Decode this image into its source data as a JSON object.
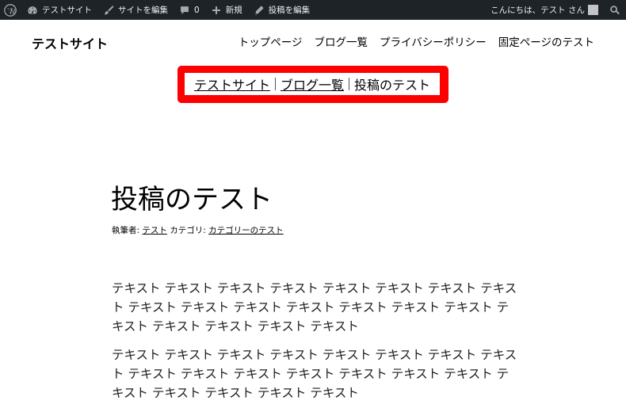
{
  "adminbar": {
    "site_name": "テストサイト",
    "edit_site": "サイトを編集",
    "comments_count": "0",
    "new": "新規",
    "edit_post": "投稿を編集",
    "greeting": "こんにちは、テスト さん"
  },
  "header": {
    "site_title": "テストサイト",
    "nav": [
      "トップページ",
      "ブログ一覧",
      "プライバシーポリシー",
      "固定ページのテスト"
    ]
  },
  "breadcrumb": {
    "items": [
      "テストサイト",
      "ブログ一覧",
      "投稿のテスト"
    ]
  },
  "post": {
    "title": "投稿のテスト",
    "author_label": "執筆者:",
    "author": "テスト",
    "category_label": "カテゴリ:",
    "category": "カテゴリーのテスト",
    "paragraphs": [
      "テキスト テキスト テキスト テキスト テキスト テキスト テキスト テキスト テキスト テキスト テキスト テキスト テキスト テキスト テキスト テキスト テキスト テキスト テキスト テキスト",
      "テキスト テキスト テキスト テキスト テキスト テキスト テキスト テキスト テキスト テキスト テキスト テキスト テキスト テキスト テキスト テキスト テキスト テキスト テキスト テキスト"
    ]
  },
  "colors": {
    "adminbar_bg": "#1d2327",
    "highlight": "#ff0000"
  }
}
